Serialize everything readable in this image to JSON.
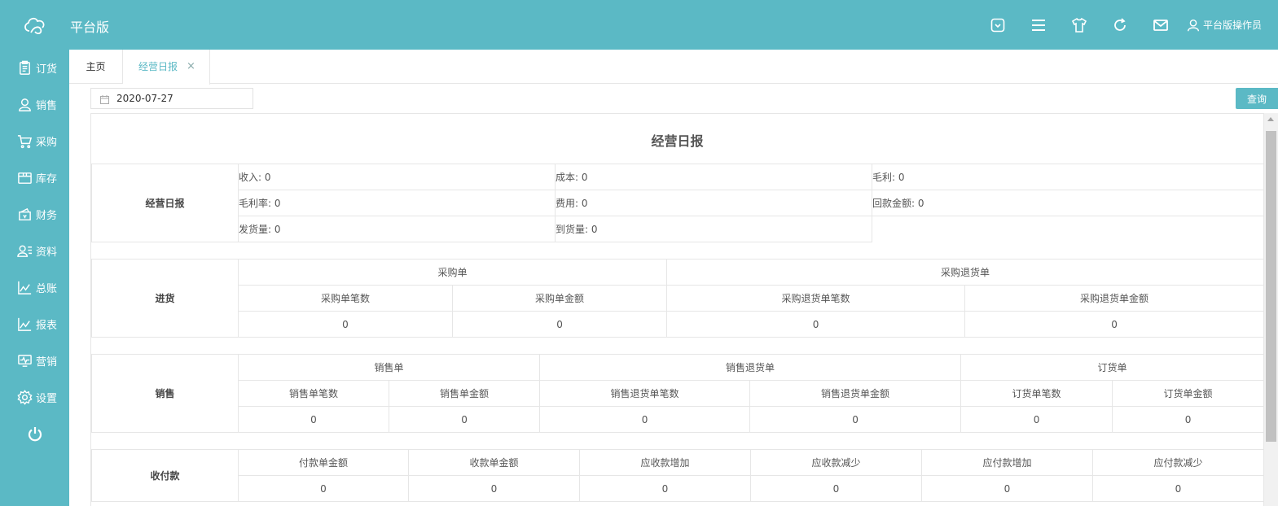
{
  "header": {
    "app_title": "平台版",
    "user_name": "平台版操作员",
    "icons": [
      "chat-box-icon",
      "menu-icon",
      "shirt-icon",
      "refresh-icon",
      "mail-icon",
      "user-icon"
    ]
  },
  "sidebar": {
    "items": [
      {
        "label": "订货",
        "icon": "order-clipboard-icon"
      },
      {
        "label": "销售",
        "icon": "person-icon"
      },
      {
        "label": "采购",
        "icon": "cart-icon"
      },
      {
        "label": "库存",
        "icon": "box-icon"
      },
      {
        "label": "财务",
        "icon": "wallet-icon"
      },
      {
        "label": "资料",
        "icon": "contacts-icon"
      },
      {
        "label": "总账",
        "icon": "line-chart-icon"
      },
      {
        "label": "报表",
        "icon": "line-chart-icon"
      },
      {
        "label": "营销",
        "icon": "monitor-pulse-icon"
      },
      {
        "label": "设置",
        "icon": "gear-icon"
      }
    ],
    "power_icon": "power-icon"
  },
  "tabs": {
    "home": "主页",
    "active": "经营日报",
    "close": "×"
  },
  "filter": {
    "date": "2020-07-27",
    "query_label": "查询"
  },
  "report": {
    "title": "经营日报",
    "summary": {
      "label": "经营日报",
      "rows": [
        [
          "收入: 0",
          "成本: 0",
          "毛利: 0"
        ],
        [
          "毛利率: 0",
          "费用: 0",
          "回款金额: 0"
        ],
        [
          "发货量: 0",
          "到货量: 0"
        ]
      ]
    },
    "purchase": {
      "label": "进货",
      "groups": [
        "采购单",
        "采购退货单"
      ],
      "columns": [
        "采购单笔数",
        "采购单金额",
        "采购退货单笔数",
        "采购退货单金额"
      ],
      "values": [
        "0",
        "0",
        "0",
        "0"
      ]
    },
    "sales": {
      "label": "销售",
      "groups": [
        "销售单",
        "销售退货单",
        "订货单"
      ],
      "columns": [
        "销售单笔数",
        "销售单金额",
        "销售退货单笔数",
        "销售退货单金额",
        "订货单笔数",
        "订货单金额"
      ],
      "values": [
        "0",
        "0",
        "0",
        "0",
        "0",
        "0"
      ]
    },
    "payments": {
      "label": "收付款",
      "columns": [
        "付款单金额",
        "收款单金额",
        "应收款增加",
        "应收款减少",
        "应付款增加",
        "应付款减少"
      ],
      "values": [
        "0",
        "0",
        "0",
        "0",
        "0",
        "0"
      ]
    }
  },
  "colors": {
    "accent": "#5bb9c5",
    "border": "#e6e6e6"
  }
}
